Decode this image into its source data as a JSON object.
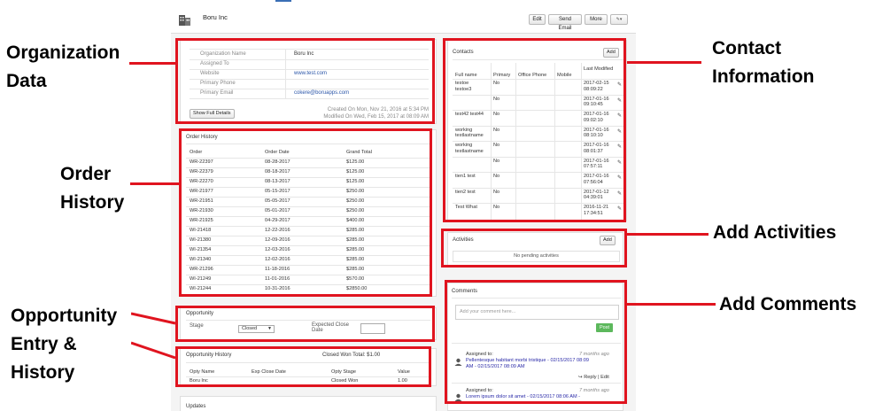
{
  "header": {
    "org_name": "Boru Inc",
    "buttons": {
      "edit": "Edit",
      "send_email": "Send Email",
      "more": "More"
    }
  },
  "organization": {
    "fields": [
      {
        "label": "Organization Name",
        "value": "Boru Inc"
      },
      {
        "label": "Assigned To",
        "value": ""
      },
      {
        "label": "Website",
        "value": "www.test.com"
      },
      {
        "label": "Primary Phone",
        "value": ""
      },
      {
        "label": "Primary Email",
        "value": "cokere@boruapps.com"
      }
    ],
    "show_full": "Show Full Details",
    "created": "Created On Mon, Nov 21, 2016 at 5:34 PM",
    "modified": "Modified On Wed, Feb 15, 2017 at 08:09 AM"
  },
  "order_history": {
    "title": "Order History",
    "columns": [
      "Order",
      "Order Date",
      "Grand Total"
    ],
    "rows": [
      [
        "WR-22397",
        "08-28-2017",
        "$125.00"
      ],
      [
        "WR-22379",
        "08-18-2017",
        "$125.00"
      ],
      [
        "WR-22270",
        "08-13-2017",
        "$125.00"
      ],
      [
        "WR-21977",
        "05-15-2017",
        "$250.00"
      ],
      [
        "WR-21951",
        "05-05-2017",
        "$250.00"
      ],
      [
        "WR-21930",
        "05-01-2017",
        "$250.00"
      ],
      [
        "WR-21925",
        "04-29-2017",
        "$400.00"
      ],
      [
        "WI-21418",
        "12-22-2016",
        "$285.00"
      ],
      [
        "WI-21380",
        "12-09-2016",
        "$285.00"
      ],
      [
        "WI-21354",
        "12-03-2016",
        "$285.00"
      ],
      [
        "WI-21340",
        "12-02-2016",
        "$285.00"
      ],
      [
        "WR-21296",
        "11-18-2016",
        "$285.00"
      ],
      [
        "WI-21249",
        "11-01-2016",
        "$570.00"
      ],
      [
        "WI-21244",
        "10-31-2016",
        "$2850.00"
      ]
    ]
  },
  "opportunity": {
    "title": "Opportunity",
    "stage_label": "Stage",
    "stage_value": "Closed",
    "close_label_1": "Expected Close",
    "close_label_2": "Date"
  },
  "opportunity_history": {
    "title": "Opportunity History",
    "total": "Closed Won Total: $1.00",
    "columns": [
      "Opty Name",
      "Exp Close Date",
      "Opty Stage",
      "Value"
    ],
    "rows": [
      [
        "Boru Inc",
        "",
        "Closed Won",
        "1.00"
      ]
    ]
  },
  "updates": {
    "title": "Updates"
  },
  "contacts": {
    "title": "Contacts",
    "add": "Add",
    "columns": [
      "Full name",
      "Primary",
      "Office Phone",
      "Mobile",
      "Last Modified"
    ],
    "rows": [
      {
        "name": [
          "testoe",
          "testoe3"
        ],
        "primary": "No",
        "modified": [
          "2017-02-15",
          "08:09:22"
        ]
      },
      {
        "name": [],
        "primary": "No",
        "modified": [
          "2017-01-16",
          "09:10:45"
        ]
      },
      {
        "name": [
          "test42 test44"
        ],
        "primary": "No",
        "modified": [
          "2017-01-16",
          "09:02:10"
        ]
      },
      {
        "name": [
          "working",
          "testlastname"
        ],
        "primary": "No",
        "modified": [
          "2017-01-16",
          "08:10:10"
        ]
      },
      {
        "name": [
          "working",
          "testlastname"
        ],
        "primary": "No",
        "modified": [
          "2017-01-16",
          "08:01:37"
        ]
      },
      {
        "name": [],
        "primary": "No",
        "modified": [
          "2017-01-16",
          "07:57:11"
        ]
      },
      {
        "name": [
          "tien1 test"
        ],
        "primary": "No",
        "modified": [
          "2017-01-16",
          "07:56:04"
        ]
      },
      {
        "name": [
          "tien2 test"
        ],
        "primary": "No",
        "modified": [
          "2017-01-12",
          "04:39:01"
        ]
      },
      {
        "name": [
          "Test What"
        ],
        "primary": "No",
        "modified": [
          "2016-11-21",
          "17:34:51"
        ]
      }
    ]
  },
  "activities": {
    "title": "Activities",
    "add": "Add",
    "empty": "No pending activities"
  },
  "comments": {
    "title": "Comments",
    "placeholder": "Add your comment here...",
    "post": "Post",
    "items": [
      {
        "assigned": "Assigned to:",
        "ago": "7 months ago",
        "line1": "Pellentesque habitant morbi tristique - 02/15/2017 08:09",
        "line2": "AM - 02/15/2017 08:09 AM",
        "actions": "Reply | Edit"
      },
      {
        "assigned": "Assigned to:",
        "ago": "7 months ago",
        "line1": "Lorem ipsum dolor sit amet - 02/15/2017 08:06 AM -",
        "line2": ""
      }
    ]
  },
  "annotations": {
    "org_1": "Organization",
    "org_2": "Data",
    "order_1": "Order",
    "order_2": "History",
    "opp_1": "Opportunity",
    "opp_2": "Entry &",
    "opp_3": "History",
    "contact_1": "Contact",
    "contact_2": "Information",
    "activities": "Add Activities",
    "comments": "Add Comments"
  },
  "colors": {
    "annotation_red": "#e0141f",
    "link_blue": "#2a55a8",
    "post_green": "#5cb85c"
  }
}
